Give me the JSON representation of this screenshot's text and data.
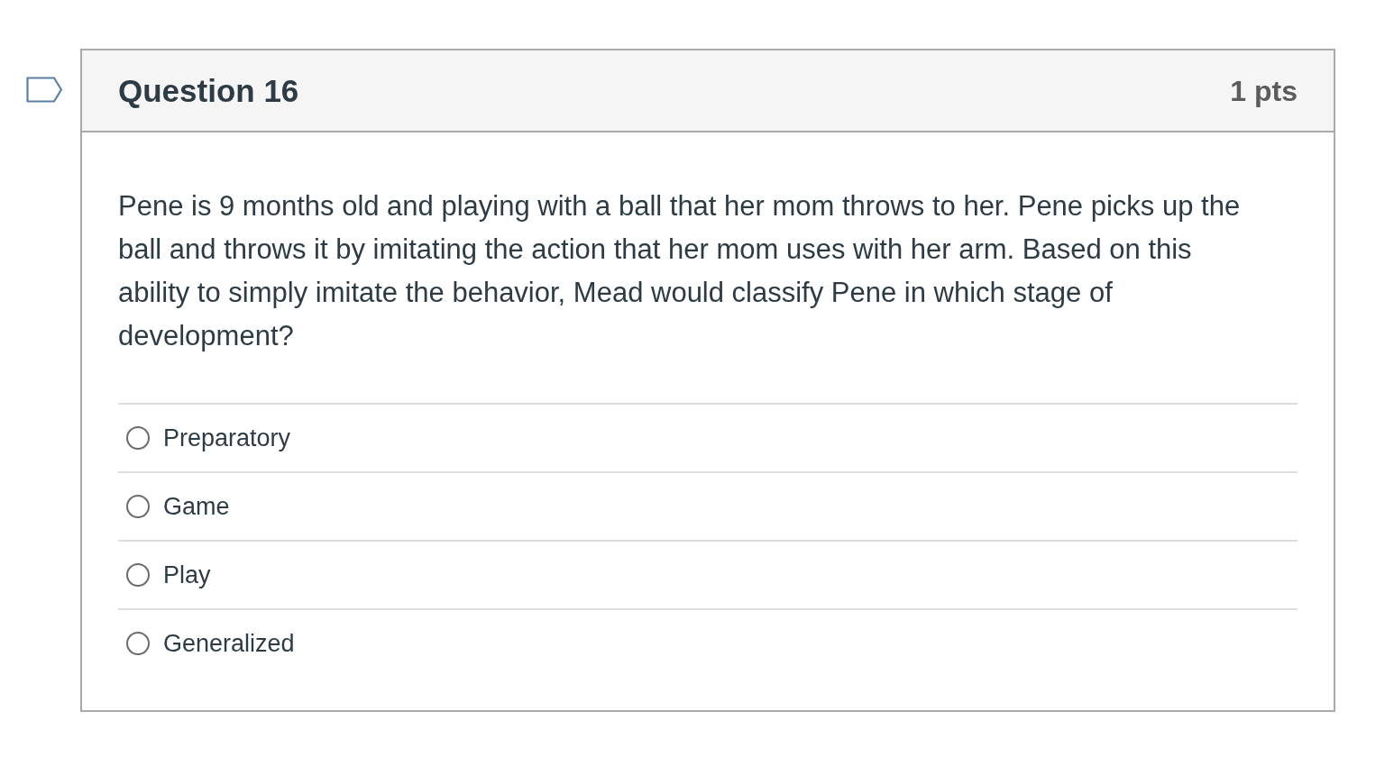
{
  "question": {
    "flagged": false,
    "title": "Question 16",
    "points": "1 pts"
  },
  "prompt": "Pene is 9 months old and playing with a ball that her mom throws to her. Pene picks up the ball and throws it by imitating the action that her mom uses with her arm. Based on this ability to simply imitate the behavior, Mead would classify Pene in which stage of development?",
  "answers": [
    {
      "label": "Preparatory",
      "selected": false
    },
    {
      "label": "Game",
      "selected": false
    },
    {
      "label": "Play",
      "selected": false
    },
    {
      "label": "Generalized",
      "selected": false
    }
  ]
}
